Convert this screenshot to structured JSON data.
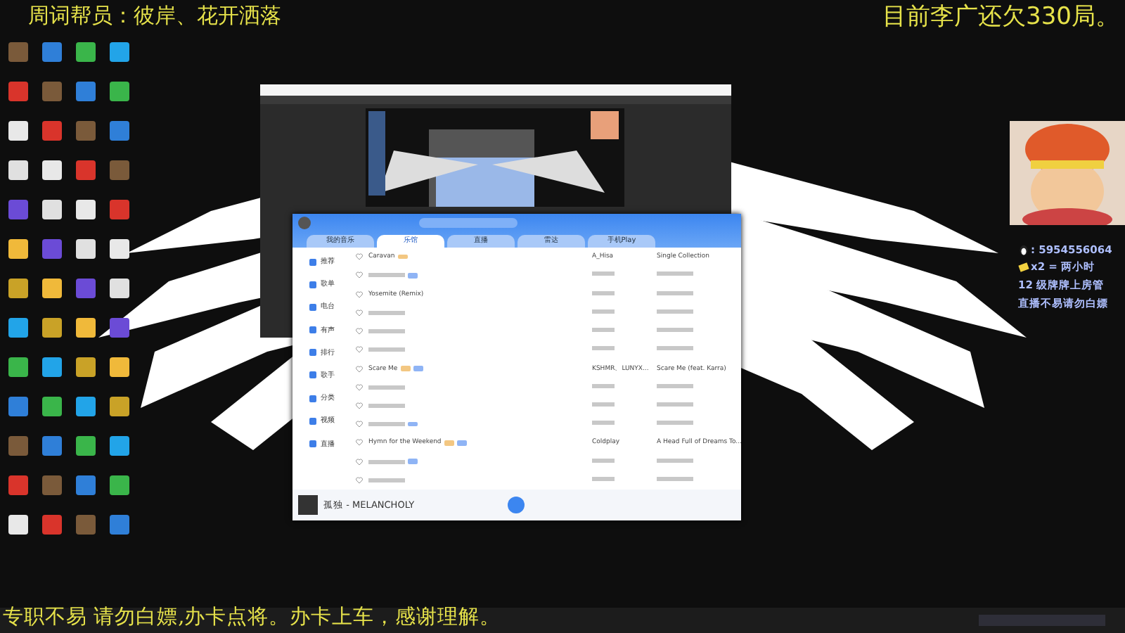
{
  "overlay": {
    "top_left": "周词帮员：彼岸、花开洒落",
    "top_right": "目前李广还欠330局。",
    "bottom": "专职不易 请勿白嫖,办卡点将。办卡上车，感谢理解。",
    "info_lines": [
      {
        "kind": "contact",
        "text": ": 5954556064"
      },
      {
        "kind": "card",
        "text": "x2 = 两小时"
      },
      {
        "kind": "plain",
        "text": "12 级牌牌上房管"
      },
      {
        "kind": "plain",
        "text": "直播不易请勿白嫖"
      }
    ]
  },
  "music_app": {
    "tabs": [
      {
        "label": "我的音乐",
        "selected": false
      },
      {
        "label": "乐馆",
        "selected": true
      },
      {
        "label": "直播",
        "selected": false
      },
      {
        "label": "雷达",
        "selected": false
      },
      {
        "label": "手机Play",
        "selected": false
      }
    ],
    "sidebar": [
      "推荐",
      "歌单",
      "电台",
      "有声",
      "排行",
      "歌手",
      "分类",
      "视频",
      "直播"
    ],
    "songs": [
      {
        "liked": false,
        "title": "Caravan",
        "artist": "A_Hisa",
        "album": "Single Collection",
        "tags": [
          {
            "color": "#f3c782"
          }
        ]
      },
      {
        "liked": false,
        "tags": [
          {
            "color": "#8fb4f5"
          }
        ]
      },
      {
        "liked": false,
        "title": "Yosemite (Remix)"
      },
      {
        "liked": false
      },
      {
        "liked": false
      },
      {
        "liked": false
      },
      {
        "liked": false,
        "title": "Scare Me",
        "artist": "KSHMR、LUNYX...",
        "album": "Scare Me (feat. Karra)",
        "tags": [
          {
            "color": "#f3c782"
          },
          {
            "color": "#8fb4f5"
          }
        ]
      },
      {
        "liked": false
      },
      {
        "liked": false
      },
      {
        "liked": false,
        "tags": [
          {
            "color": "#8fb4f5"
          }
        ]
      },
      {
        "liked": false,
        "title": "Hymn for the Weekend",
        "artist": "Coldplay",
        "album": "A Head Full of Dreams To...",
        "tags": [
          {
            "color": "#f3c782"
          },
          {
            "color": "#8fb4f5"
          }
        ]
      },
      {
        "liked": false,
        "tags": [
          {
            "color": "#8fb4f5"
          }
        ]
      },
      {
        "liked": false
      }
    ],
    "player": {
      "now_playing": "孤独 - MELANCHOLY"
    }
  }
}
